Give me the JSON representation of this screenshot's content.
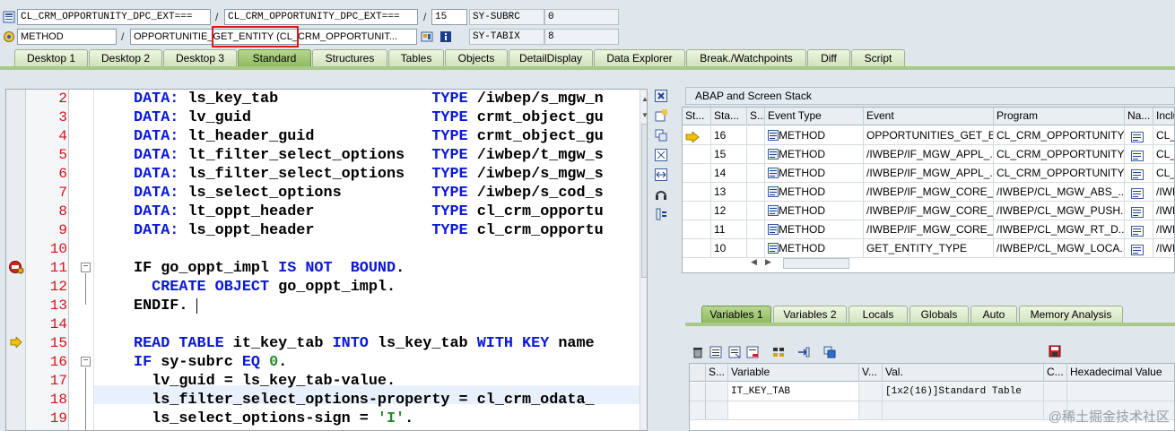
{
  "top": {
    "row1": {
      "program": "CL_CRM_OPPORTUNITY_DPC_EXT===",
      "include": "CL_CRM_OPPORTUNITY_DPC_EXT===",
      "line": "15",
      "sysvar_label": "SY-SUBRC",
      "sysvar_value": "0"
    },
    "row2": {
      "event_type": "METHOD",
      "event_prefix": "OPPORTUNITIE",
      "event_highlight": "_GET_ENTITY (",
      "event_class": "CL_CRM_OPPORTUNIT...",
      "sysvar_label": "SY-TABIX",
      "sysvar_value": "8"
    },
    "separator": "/"
  },
  "tabs": [
    "Desktop 1",
    "Desktop 2",
    "Desktop 3",
    "Standard",
    "Structures",
    "Tables",
    "Objects",
    "DetailDisplay",
    "Data Explorer",
    "Break./Watchpoints",
    "Diff",
    "Script"
  ],
  "active_tab": "Standard",
  "code": {
    "lines": [
      {
        "no": "2",
        "segs": [
          [
            "kw",
            "DATA: "
          ],
          [
            "plain",
            "ls_key_tab                 "
          ],
          [
            "kw",
            "TYPE "
          ],
          [
            "plain",
            "/iwbep/s_mgw_n"
          ]
        ]
      },
      {
        "no": "3",
        "segs": [
          [
            "kw",
            "DATA: "
          ],
          [
            "plain",
            "lv_guid                    "
          ],
          [
            "kw",
            "TYPE "
          ],
          [
            "plain",
            "crmt_object_gu"
          ]
        ]
      },
      {
        "no": "4",
        "segs": [
          [
            "kw",
            "DATA: "
          ],
          [
            "plain",
            "lt_header_guid             "
          ],
          [
            "kw",
            "TYPE "
          ],
          [
            "plain",
            "crmt_object_gu"
          ]
        ]
      },
      {
        "no": "5",
        "segs": [
          [
            "kw",
            "DATA: "
          ],
          [
            "plain",
            "lt_filter_select_options   "
          ],
          [
            "kw",
            "TYPE "
          ],
          [
            "plain",
            "/iwbep/t_mgw_s"
          ]
        ]
      },
      {
        "no": "6",
        "segs": [
          [
            "kw",
            "DATA: "
          ],
          [
            "plain",
            "ls_filter_select_options   "
          ],
          [
            "kw",
            "TYPE "
          ],
          [
            "plain",
            "/iwbep/s_mgw_s"
          ]
        ]
      },
      {
        "no": "7",
        "segs": [
          [
            "kw",
            "DATA: "
          ],
          [
            "plain",
            "ls_select_options          "
          ],
          [
            "kw",
            "TYPE "
          ],
          [
            "plain",
            "/iwbep/s_cod_s"
          ]
        ]
      },
      {
        "no": "8",
        "segs": [
          [
            "kw",
            "DATA: "
          ],
          [
            "plain",
            "lt_oppt_header             "
          ],
          [
            "kw",
            "TYPE "
          ],
          [
            "plain",
            "cl_crm_opportu"
          ]
        ]
      },
      {
        "no": "9",
        "segs": [
          [
            "kw",
            "DATA: "
          ],
          [
            "plain",
            "ls_oppt_header             "
          ],
          [
            "kw",
            "TYPE "
          ],
          [
            "plain",
            "cl_crm_opportu"
          ]
        ]
      },
      {
        "no": "10",
        "segs": []
      },
      {
        "no": "11",
        "segs": [
          [
            "plain",
            "IF go_oppt_impl "
          ],
          [
            "kw",
            "IS NOT  BOUND"
          ],
          [
            "plain",
            "."
          ]
        ]
      },
      {
        "no": "12",
        "segs": [
          [
            "plain",
            "  "
          ],
          [
            "kw",
            "CREATE OBJECT "
          ],
          [
            "plain",
            "go_oppt_impl."
          ]
        ]
      },
      {
        "no": "13",
        "segs": [
          [
            "plain",
            "ENDIF."
          ]
        ]
      },
      {
        "no": "14",
        "segs": []
      },
      {
        "no": "15",
        "segs": [
          [
            "kw",
            "READ TABLE "
          ],
          [
            "plain",
            "it_key_tab "
          ],
          [
            "kw",
            "INTO "
          ],
          [
            "plain",
            "ls_key_tab "
          ],
          [
            "kw",
            "WITH KEY "
          ],
          [
            "plain",
            "name"
          ]
        ]
      },
      {
        "no": "16",
        "segs": [
          [
            "kw",
            "IF "
          ],
          [
            "plain",
            "sy-subrc "
          ],
          [
            "kw",
            "EQ "
          ],
          [
            "num",
            "0"
          ],
          [
            "plain",
            "."
          ]
        ]
      },
      {
        "no": "17",
        "segs": [
          [
            "plain",
            "  lv_guid = ls_key_tab-value."
          ]
        ]
      },
      {
        "no": "18",
        "segs": [
          [
            "plain",
            "  ls_filter_select_options-property = cl_crm_odata_"
          ]
        ]
      },
      {
        "no": "19",
        "segs": [
          [
            "plain",
            "  ls_select_options-sign = "
          ],
          [
            "str",
            "'I'"
          ],
          [
            "plain",
            "."
          ]
        ]
      }
    ]
  },
  "stack": {
    "title": "ABAP and Screen Stack",
    "headers": [
      "St...",
      "Sta...",
      "S...",
      "Event Type",
      "Event",
      "Program",
      "Na...",
      "Inclu"
    ],
    "rows": [
      {
        "level": "16",
        "type": "METHOD",
        "event": "OPPORTUNITIES_GET_E...",
        "program": "CL_CRM_OPPORTUNITY...",
        "include": "CL_C"
      },
      {
        "level": "15",
        "type": "METHOD",
        "event": "/IWBEP/IF_MGW_APPL_...",
        "program": "CL_CRM_OPPORTUNITY...",
        "include": "CL_C"
      },
      {
        "level": "14",
        "type": "METHOD",
        "event": "/IWBEP/IF_MGW_APPL_...",
        "program": "CL_CRM_OPPORTUNITY...",
        "include": "CL_C"
      },
      {
        "level": "13",
        "type": "METHOD",
        "event": "/IWBEP/IF_MGW_CORE_...",
        "program": "/IWBEP/CL_MGW_ABS_...",
        "include": "/IWB"
      },
      {
        "level": "12",
        "type": "METHOD",
        "event": "/IWBEP/IF_MGW_CORE_...",
        "program": "/IWBEP/CL_MGW_PUSH...",
        "include": "/IWB"
      },
      {
        "level": "11",
        "type": "METHOD",
        "event": "/IWBEP/IF_MGW_CORE_...",
        "program": "/IWBEP/CL_MGW_RT_D...",
        "include": "/IWB"
      },
      {
        "level": "10",
        "type": "METHOD",
        "event": "GET_ENTITY_TYPE",
        "program": "/IWBEP/CL_MGW_LOCA...",
        "include": "/IWB"
      }
    ]
  },
  "var_tabs": [
    "Variables 1",
    "Variables 2",
    "Locals",
    "Globals",
    "Auto",
    "Memory Analysis"
  ],
  "variables": {
    "headers": [
      "S...",
      "Variable",
      "V...",
      "Val.",
      "C...",
      "Hexadecimal Value"
    ],
    "rows": [
      {
        "variable": "IT_KEY_TAB",
        "value": "[1x2(16)]Standard Table"
      }
    ]
  },
  "watermark": "@稀土掘金技术社区",
  "colors": {
    "keyword": "#0a18d8",
    "line_number": "#d0141e",
    "active_tab": "#8dbb5c",
    "highlight_box": "#e01818"
  }
}
